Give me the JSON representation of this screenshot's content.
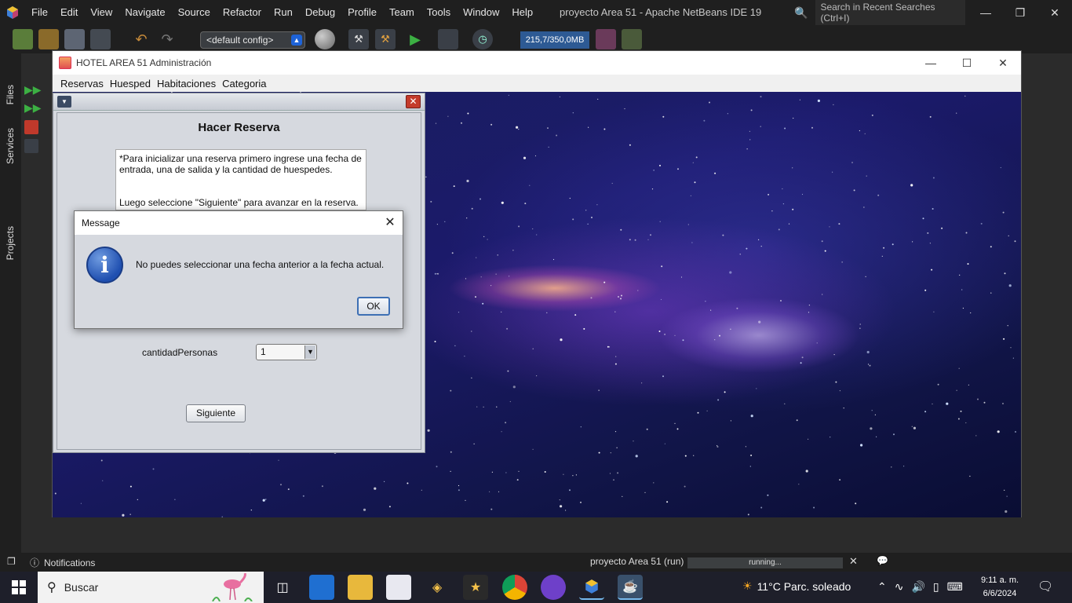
{
  "netbeans": {
    "menu": [
      "File",
      "Edit",
      "View",
      "Navigate",
      "Source",
      "Refactor",
      "Run",
      "Debug",
      "Profile",
      "Team",
      "Tools",
      "Window",
      "Help"
    ],
    "title": "proyecto Area 51 - Apache NetBeans IDE 19",
    "search_placeholder": "Search in Recent Searches (Ctrl+I)",
    "config": "<default config>",
    "memory": "215,7/350,0MB",
    "side_tabs": [
      "Files",
      "Services",
      "Projects"
    ],
    "notifications_label": "Notifications",
    "run_label": "proyecto Area 51 (run)",
    "progress_text": "running...",
    "colors": {
      "chrome": "#1f1f1f",
      "memory_bar": "#2d5a94"
    }
  },
  "app": {
    "title": "HOTEL AREA 51 Administración",
    "menu": [
      "Reservas",
      "Huesped",
      "Habitaciones",
      "Categoria"
    ]
  },
  "reservation": {
    "heading": "Hacer Reserva",
    "instructions_1": "*Para inicializar una reserva primero ingrese una fecha de entrada, una de salida y la cantidad de huespedes.",
    "instructions_2": "Luego seleccione \"Siguiente\" para avanzar en la reserva.",
    "personas_label": "cantidadPersonas",
    "personas_value": "1",
    "next_label": "Siguiente"
  },
  "dialog": {
    "title": "Message",
    "message": "No puedes seleccionar una fecha anterior a la fecha actual.",
    "ok_label": "OK",
    "icon": "info-icon"
  },
  "taskbar": {
    "search_text": "Buscar",
    "weather": "11°C  Parc. soleado",
    "time": "9:11 a. m.",
    "date": "6/6/2024"
  }
}
